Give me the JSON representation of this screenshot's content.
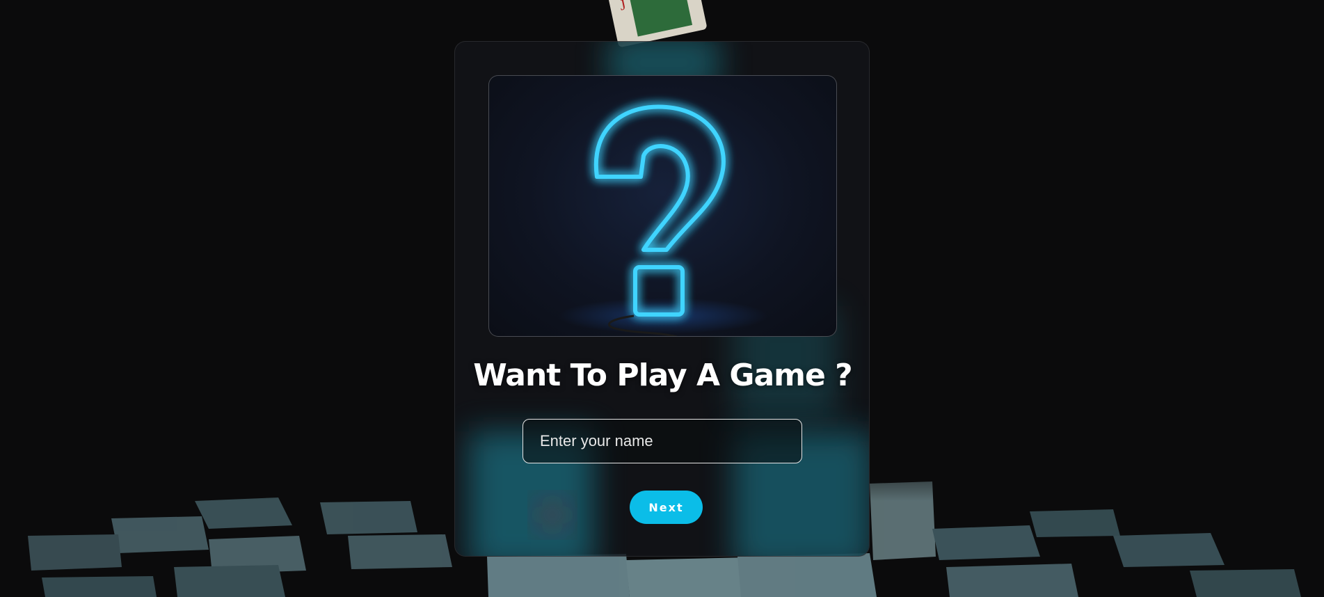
{
  "modal": {
    "title": "Want To Play A Game ?",
    "hero_image": "neon-question-mark",
    "name_input": {
      "value": "",
      "placeholder": "Enter your name"
    },
    "next_label": "Next"
  },
  "background": {
    "image": "scattered-playing-cards",
    "accent": "#0bbde8"
  },
  "colors": {
    "accent": "#0bbde8",
    "neon": "#3fd4ff",
    "page": "#0b0b0c"
  }
}
